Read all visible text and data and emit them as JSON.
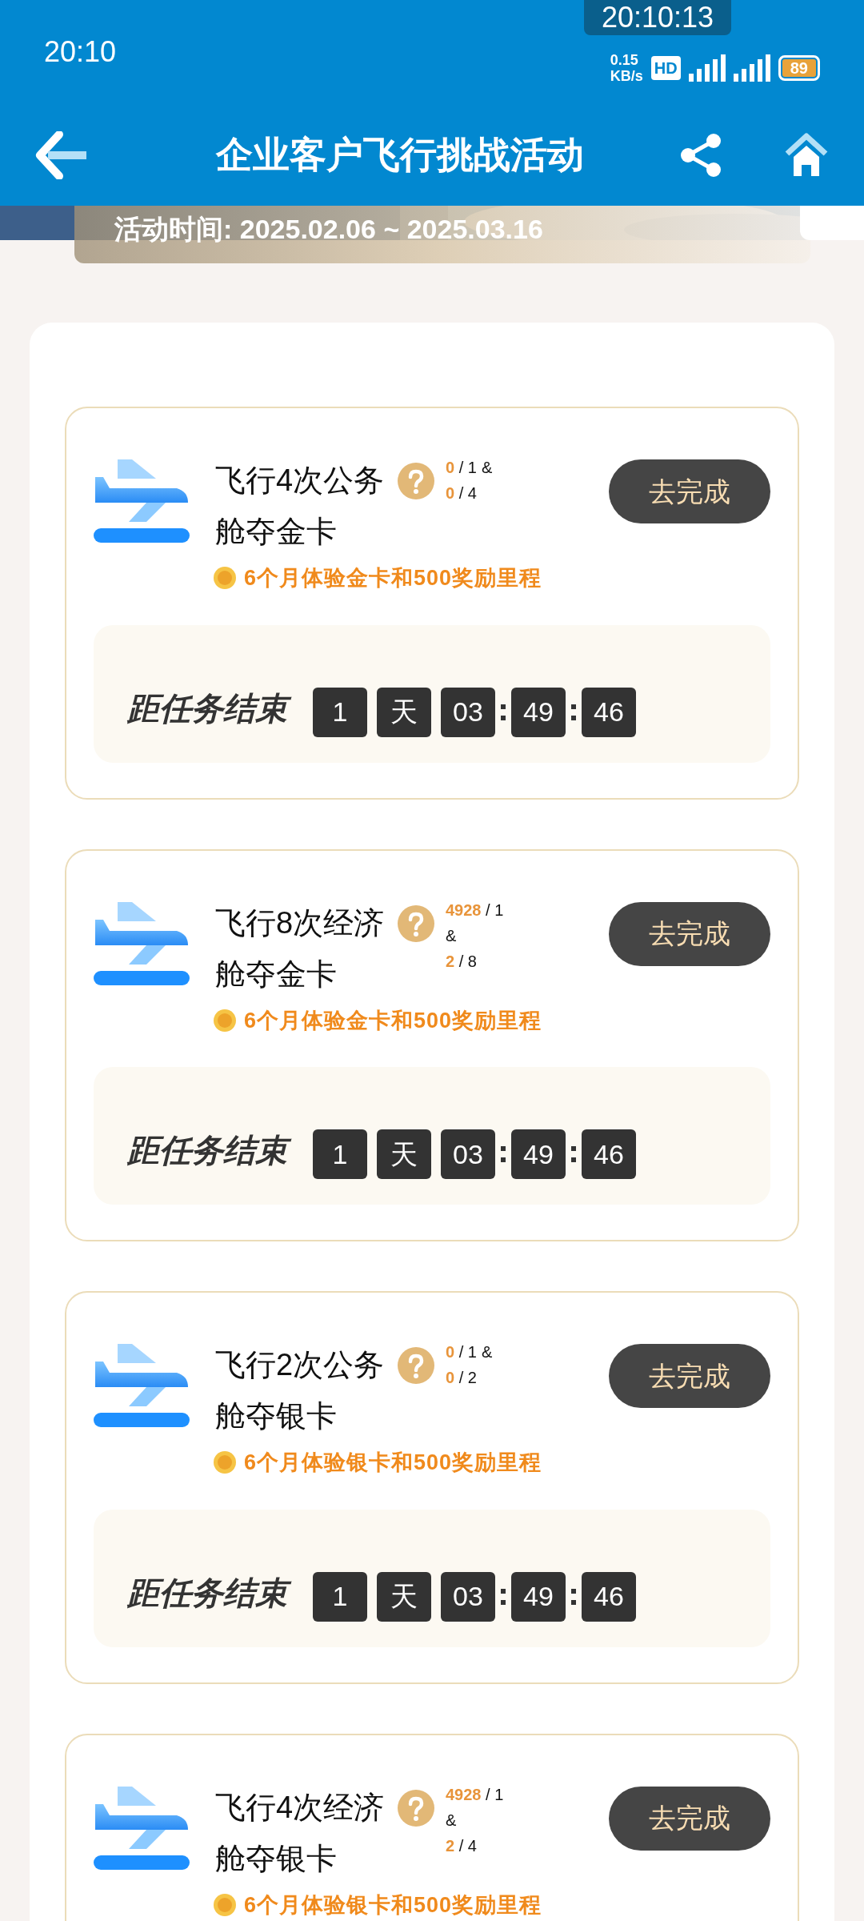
{
  "status_bar": {
    "time": "20:10",
    "recorder_time": "20:10:13",
    "net_speed": "0.15",
    "net_unit": "KB/s",
    "hd": "HD",
    "battery": "89"
  },
  "header": {
    "title": "企业客户飞行挑战活动"
  },
  "banner": {
    "period": "活动时间: 2025.02.06 ~ 2025.03.16"
  },
  "tasks": [
    {
      "title": "飞行4次公务舱夺金卡",
      "progress": [
        {
          "current": "0",
          "total": "1"
        },
        {
          "current": "0",
          "total": "4"
        }
      ],
      "separator": "&",
      "slash": "/",
      "button": "去完成",
      "reward": "6个月体验金卡和500奖励里程",
      "countdown_label": "距任务结束",
      "countdown": [
        "1",
        "天",
        "03",
        "49",
        "46"
      ]
    },
    {
      "title": "飞行8次经济舱夺金卡",
      "progress": [
        {
          "current": "4928",
          "total": "1"
        },
        {
          "current": "2",
          "total": "8"
        }
      ],
      "separator": "&",
      "slash": "/",
      "button": "去完成",
      "reward": "6个月体验金卡和500奖励里程",
      "countdown_label": "距任务结束",
      "countdown": [
        "1",
        "天",
        "03",
        "49",
        "46"
      ]
    },
    {
      "title": "飞行2次公务舱夺银卡",
      "progress": [
        {
          "current": "0",
          "total": "1"
        },
        {
          "current": "0",
          "total": "2"
        }
      ],
      "separator": "&",
      "slash": "/",
      "button": "去完成",
      "reward": "6个月体验银卡和500奖励里程",
      "countdown_label": "距任务结束",
      "countdown": [
        "1",
        "天",
        "03",
        "49",
        "46"
      ]
    },
    {
      "title": "飞行4次经济舱夺银卡",
      "progress": [
        {
          "current": "4928",
          "total": "1"
        },
        {
          "current": "2",
          "total": "4"
        }
      ],
      "separator": "&",
      "slash": "/",
      "button": "去完成",
      "reward": "6个月体验银卡和500奖励里程"
    }
  ]
}
